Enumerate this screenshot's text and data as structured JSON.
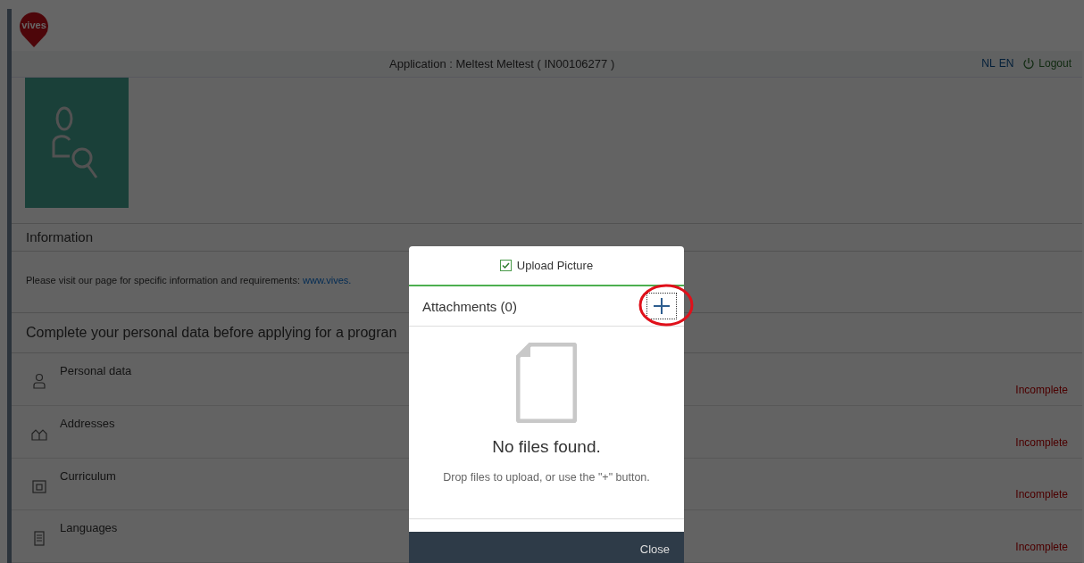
{
  "logo": {
    "text": "vives"
  },
  "header": {
    "title": "Application : Meltest Meltest ( IN00106277 )",
    "languages": [
      "NL",
      "EN"
    ],
    "logout": "Logout"
  },
  "information": {
    "title": "Information",
    "text": "Please visit our page for specific information and requirements: ",
    "link": "www.vives."
  },
  "personal": {
    "title": "Complete your personal data before applying for a progran",
    "items": [
      {
        "kind": "person",
        "label": "Personal data",
        "status": "Incomplete"
      },
      {
        "kind": "houses",
        "label": "Addresses",
        "status": "Incomplete"
      },
      {
        "kind": "folder",
        "label": "Curriculum",
        "status": "Incomplete"
      },
      {
        "kind": "list",
        "label": "Languages",
        "status": "Incomplete"
      }
    ]
  },
  "dialog": {
    "title": "Upload Picture",
    "checked": true,
    "attachments": "Attachments (0)",
    "empty_title": "No files found.",
    "empty_text": "Drop files to upload, or use the \"+\" button.",
    "close": "Close",
    "highlighted": true
  }
}
